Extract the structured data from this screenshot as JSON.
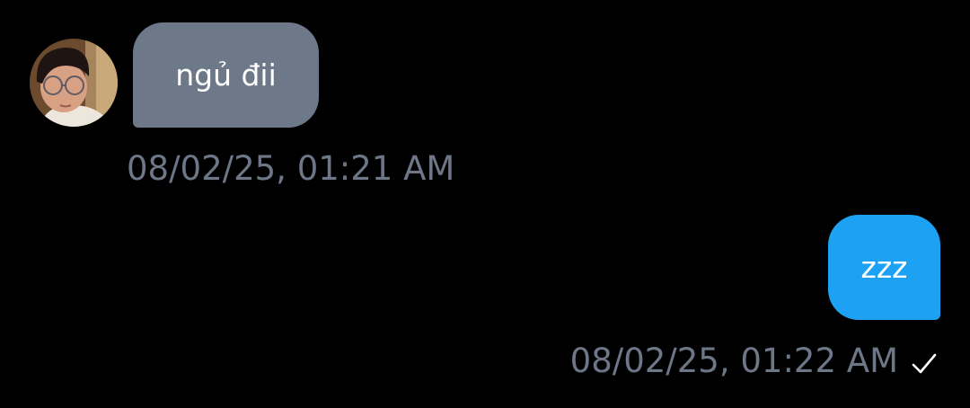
{
  "conversation": {
    "messages": [
      {
        "direction": "incoming",
        "text": "ngủ đii",
        "timestamp": "08/02/25, 01:21 AM",
        "bubble_color": "#6d7989",
        "has_avatar": true
      },
      {
        "direction": "outgoing",
        "text": "zzz",
        "timestamp": "08/02/25, 01:22 AM",
        "bubble_color": "#1da1f2",
        "status_icon": "checkmark-icon"
      }
    ]
  },
  "colors": {
    "background": "#000000",
    "timestamp_text": "#6d7787",
    "message_text": "#ffffff"
  }
}
